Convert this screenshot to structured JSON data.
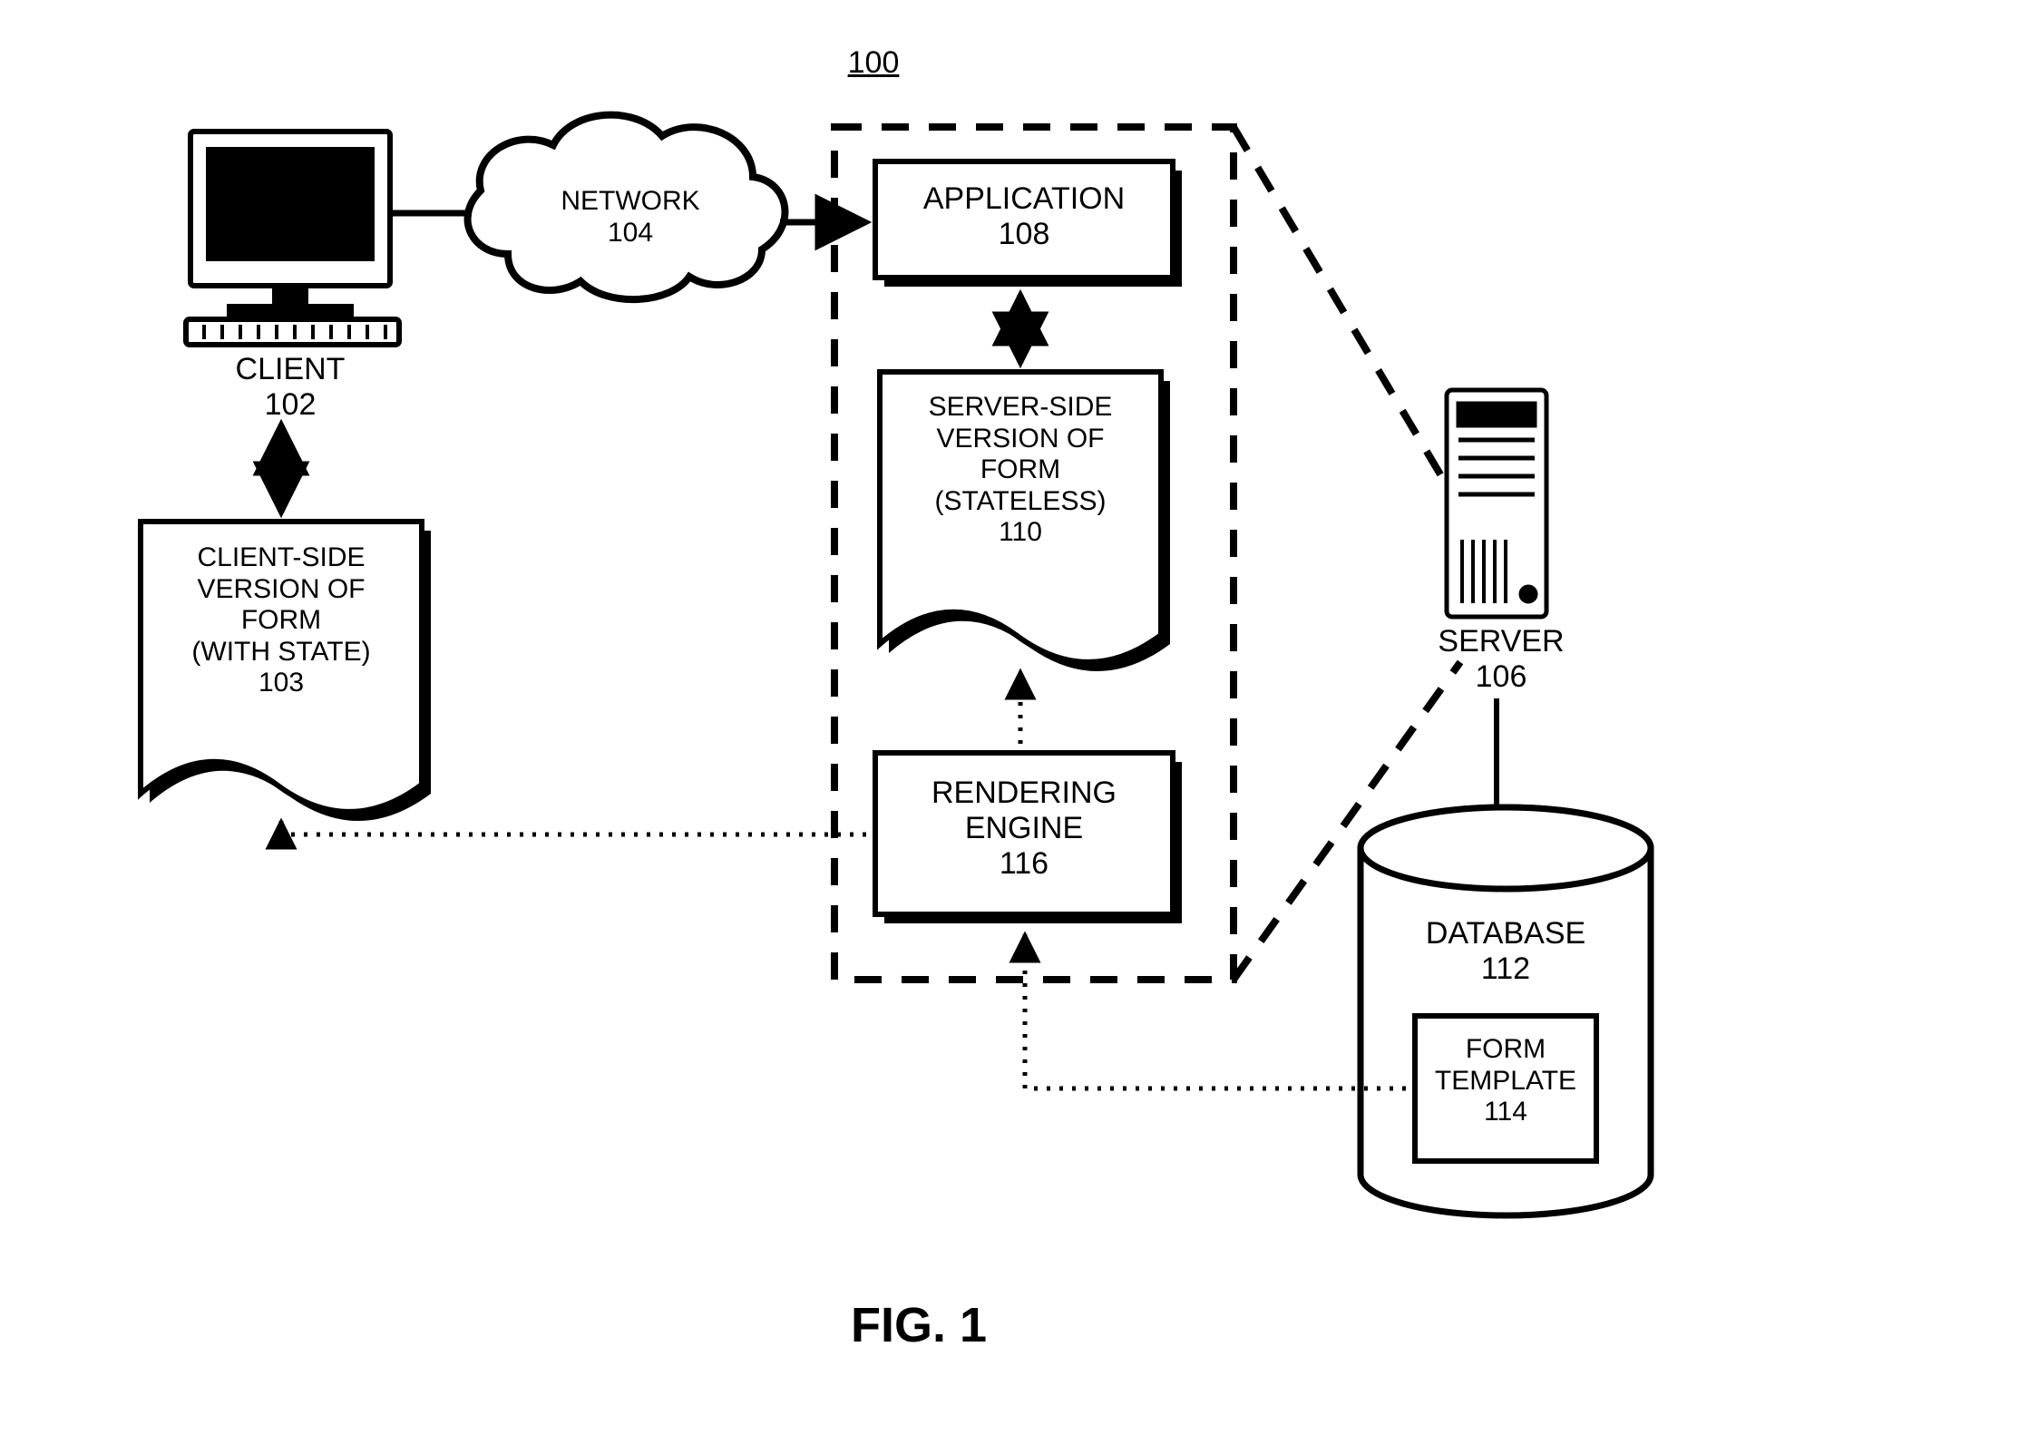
{
  "figure_ref": "100",
  "caption": "FIG. 1",
  "nodes": {
    "client": {
      "label": "CLIENT",
      "ref": "102"
    },
    "network": {
      "label": "NETWORK",
      "ref": "104"
    },
    "application": {
      "label": "APPLICATION",
      "ref": "108"
    },
    "server": {
      "label": "SERVER",
      "ref": "106"
    },
    "client_form": {
      "line1": "CLIENT-SIDE",
      "line2": "VERSION OF",
      "line3": "FORM",
      "line4": "(WITH STATE)",
      "ref": "103"
    },
    "server_form": {
      "line1": "SERVER-SIDE",
      "line2": "VERSION OF",
      "line3": "FORM",
      "line4": "(STATELESS)",
      "ref": "110"
    },
    "render_engine": {
      "line1": "RENDERING",
      "line2": "ENGINE",
      "ref": "116"
    },
    "database": {
      "label": "DATABASE",
      "ref": "112"
    },
    "form_template": {
      "line1": "FORM",
      "line2": "TEMPLATE",
      "ref": "114"
    }
  }
}
